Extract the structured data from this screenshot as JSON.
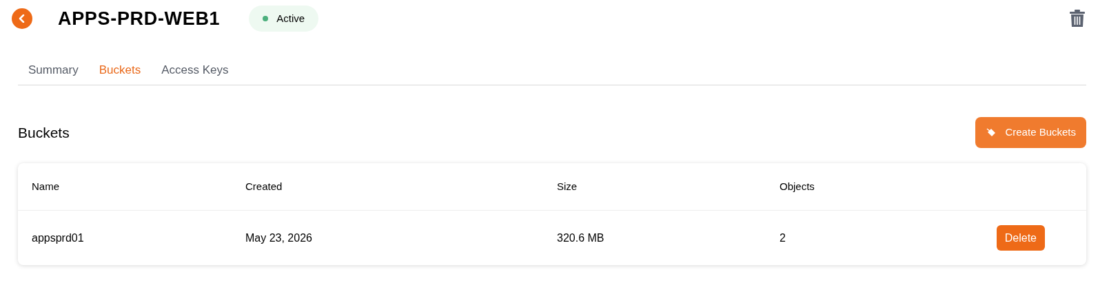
{
  "header": {
    "title": "APPS-PRD-WEB1",
    "status": {
      "label": "Active",
      "color": "#4caf7d"
    }
  },
  "tabs": [
    {
      "label": "Summary",
      "selected": false
    },
    {
      "label": "Buckets",
      "selected": true
    },
    {
      "label": "Access Keys",
      "selected": false
    }
  ],
  "section": {
    "title": "Buckets",
    "create_button": "Create Buckets"
  },
  "table": {
    "columns": [
      "Name",
      "Created",
      "Size",
      "Objects"
    ],
    "rows": [
      {
        "cells": [
          "appsprd01",
          "May 23, 2026",
          "320.6 MB",
          "2"
        ],
        "action": "Delete"
      }
    ]
  }
}
